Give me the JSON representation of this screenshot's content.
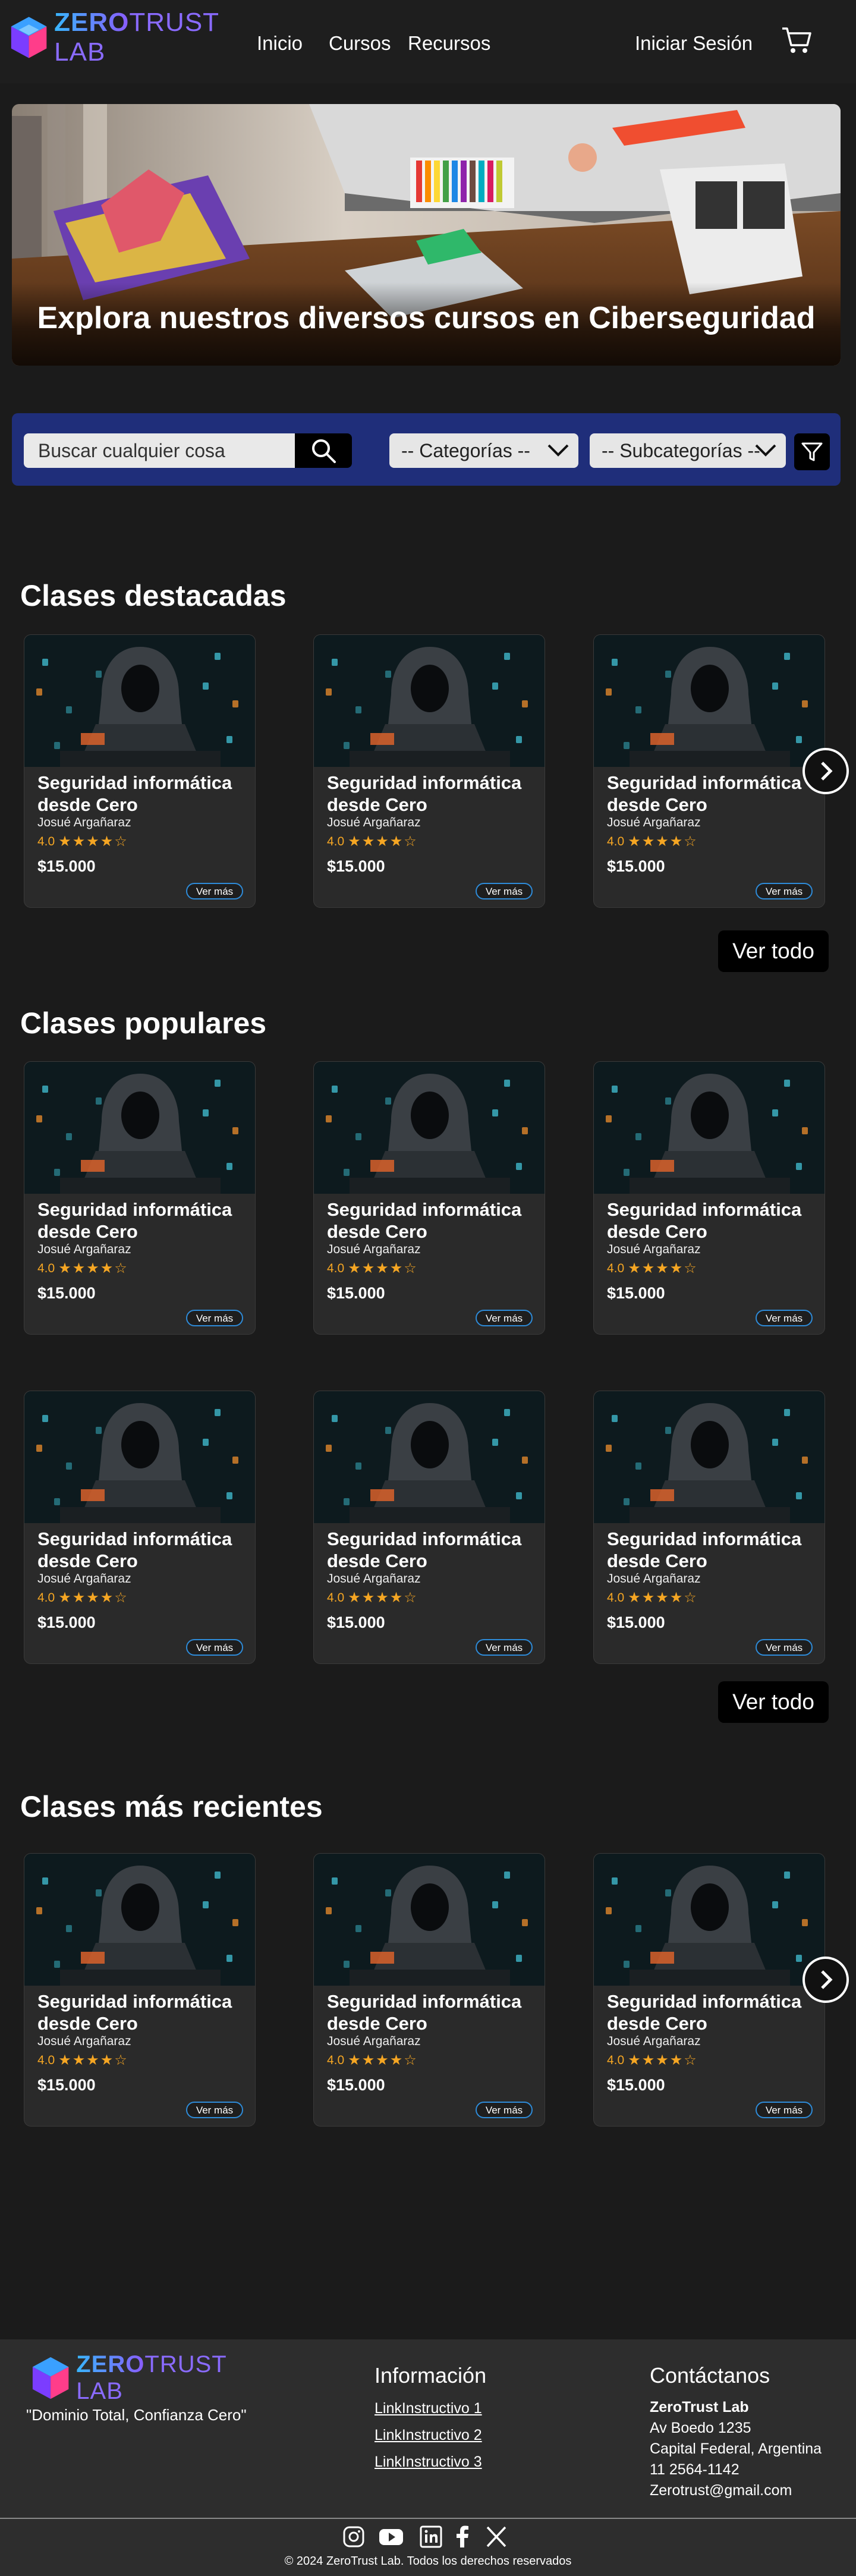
{
  "brand": {
    "name_part1": "ZERO",
    "name_part2": "TRUST LAB"
  },
  "nav": {
    "inicio": "Inicio",
    "cursos": "Cursos",
    "recursos": "Recursos",
    "login": "Iniciar Sesión",
    "cart_icon": "cart-icon"
  },
  "hero": {
    "title": "Explora nuestros diversos cursos en Ciberseguridad"
  },
  "search": {
    "placeholder": "Buscar cualquier cosa",
    "category_select": "-- Categorías --",
    "subcategory_select": "-- Subcategorías --",
    "search_icon": "search-icon",
    "filter_icon": "filter-icon"
  },
  "sections": {
    "featured": "Clases destacadas",
    "popular": "Clases populares",
    "recent": "Clases más recientes",
    "ver_todo": "Ver todo"
  },
  "card": {
    "title": "Seguridad informática desde Cero",
    "author": "Josué Argañaraz",
    "rating": "4.0",
    "stars_filled": 4,
    "stars_total": 5,
    "price": "$15.000",
    "more": "Ver más"
  },
  "footer": {
    "tagline": "\"Dominio Total, Confianza Cero\"",
    "info_title": "Información",
    "links": [
      "LinkInstructivo 1",
      "LinkInstructivo 2",
      "LinkInstructivo 3"
    ],
    "contact_title": "Contáctanos",
    "contact_name": "ZeroTrust Lab",
    "contact_lines": [
      "Av Boedo 1235",
      "Capital Federal, Argentina",
      "11 2564-1142",
      "Zerotrust@gmail.com"
    ],
    "copyright": "© 2024 ZeroTrust Lab. Todos los derechos reservados",
    "social_icons": [
      "instagram-icon",
      "youtube-icon",
      "linkedin-icon",
      "facebook-icon",
      "x-icon"
    ]
  },
  "colors": {
    "background": "#1b1b1b",
    "searchbar": "#1f2e7a",
    "accent_star": "#f5a623",
    "more_border": "#2e8bd8"
  }
}
